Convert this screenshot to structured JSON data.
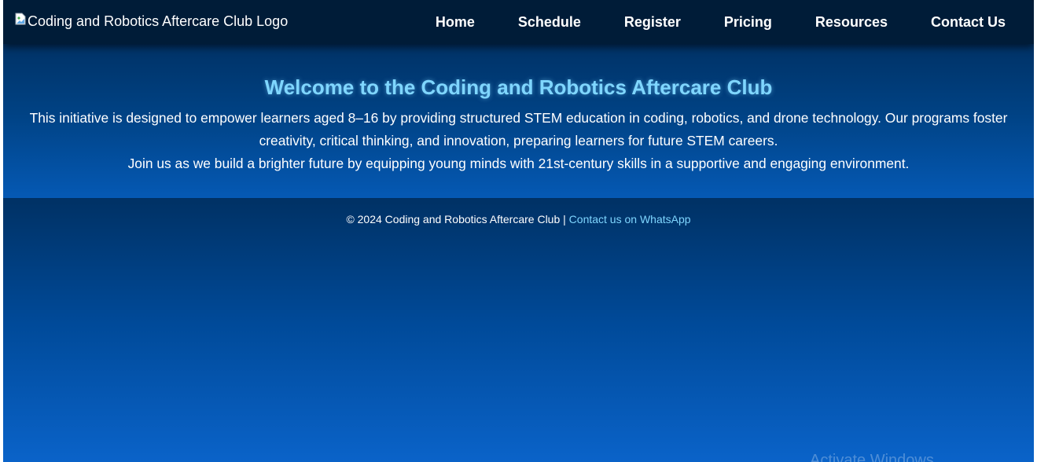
{
  "header": {
    "logo_alt": "Coding and Robotics Aftercare Club Logo",
    "nav": [
      {
        "label": "Home"
      },
      {
        "label": "Schedule"
      },
      {
        "label": "Register"
      },
      {
        "label": "Pricing"
      },
      {
        "label": "Resources"
      },
      {
        "label": "Contact Us"
      }
    ]
  },
  "hero": {
    "title": "Welcome to the Coding and Robotics Aftercare Club",
    "paragraph1": "This initiative is designed to empower learners aged 8–16 by providing structured STEM education in coding, robotics, and drone technology. Our programs foster creativity, critical thinking, and innovation, preparing learners for future STEM careers.",
    "paragraph2": "Join us as we build a brighter future by equipping young minds with 21st-century skills in a supportive and engaging environment."
  },
  "footer": {
    "copyright": "© 2024 Coding and Robotics Aftercare Club | ",
    "whatsapp_link": "Contact us on WhatsApp"
  },
  "os_overlay": {
    "watermark": "Activate Windows"
  },
  "colors": {
    "nav_bg": "#001c38",
    "accent": "#7fd6ff",
    "hero_bottom": "#0559b4"
  }
}
